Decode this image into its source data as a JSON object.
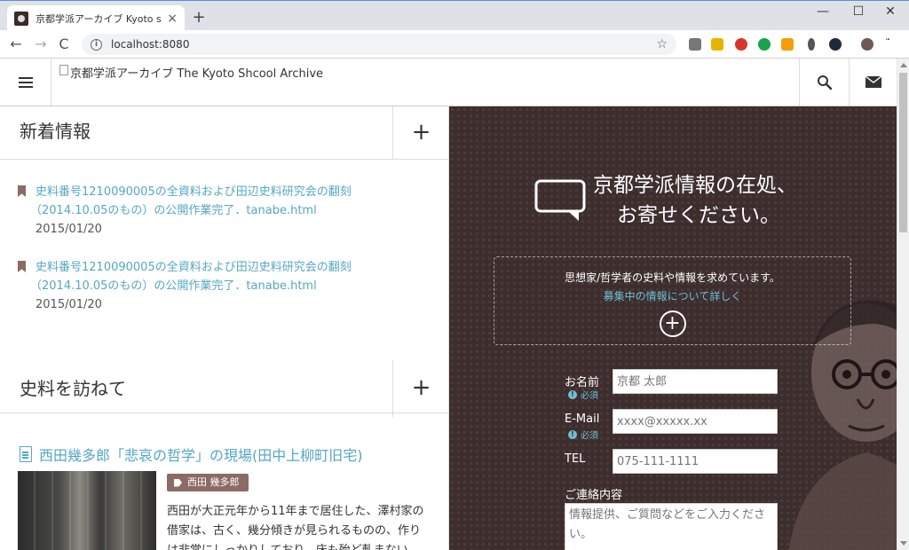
{
  "browser": {
    "tab_title": "京都学派アーカイブ Kyoto shcool a",
    "tab_close": "×",
    "new_tab": "+",
    "minimize": "—",
    "maximize": "☐",
    "close": "✕",
    "back": "←",
    "forward": "→",
    "reload": "C",
    "url": "localhost:8080",
    "bookmark_star": "☆",
    "info": "i"
  },
  "header": {
    "logo_alt": "京都学派アーカイブ The Kyoto Shcool Archive"
  },
  "news": {
    "title": "新着情報",
    "plus": "+",
    "items": [
      {
        "link_line1": "史料番号1210090005の全資料および田辺史料研究会の翻刻",
        "link_line2": "（2014.10.05のもの）の公開作業完了．tanabe.html",
        "date": "2015/01/20"
      },
      {
        "link_line1": "史料番号1210090005の全資料および田辺史料研究会の翻刻",
        "link_line2": "（2014.10.05のもの）の公開作業完了．tanabe.html",
        "date": "2015/01/20"
      }
    ]
  },
  "visit": {
    "title": "史料を訪ねて",
    "plus": "+",
    "article_title": "西田幾多郎「悲哀の哲学」の現場(田中上柳町旧宅)",
    "tag": "西田 幾多郎",
    "body_line1": "西田が大正元年から11年まで居住した、澤村家の",
    "body_line2": "借家は、古く、幾分傾きが見られるものの、作り",
    "body_line3": "は非常にしっかりしており、床も殆ど軋まない。"
  },
  "contact": {
    "heading_line1": "京都学派情報の在処、",
    "heading_line2": "お寄せください。",
    "info_line": "思想家/哲学者の史料や情報を求めています。",
    "info_link": "募集中の情報について詳しく",
    "info_plus": "+",
    "required_label": "必須",
    "name_label": "お名前",
    "name_placeholder": "京都 太郎",
    "email_label": "E-Mail",
    "email_placeholder": "xxxx@xxxxx.xx",
    "tel_label": "TEL",
    "tel_placeholder": "075-111-1111",
    "message_label": "ご連絡内容",
    "message_placeholder": "情報提供、ご質問などをご入力ください。"
  },
  "colors": {
    "accent_link": "#55a7c4",
    "tag_brown": "#8b6b63",
    "panel_bg": "#3d2d2d"
  }
}
